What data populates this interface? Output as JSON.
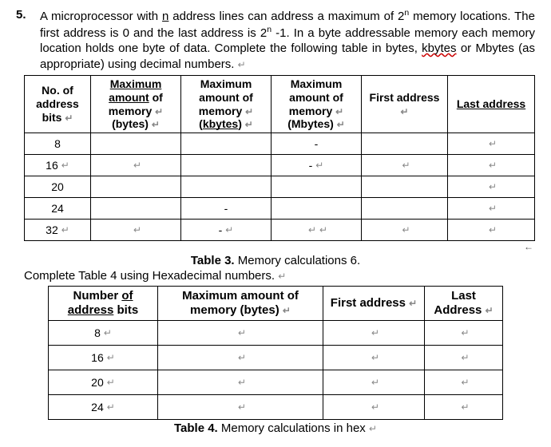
{
  "question": {
    "number": "5.",
    "text_part1": "A microprocessor with ",
    "text_n": "n",
    "text_part2": " address lines can address a maximum of 2",
    "text_exp": "n",
    "text_part3": " memory locations. The first address is 0 and the last address is 2",
    "text_exp2": "n",
    "text_part4": " -1.  In a byte addressable memory each memory location holds one byte of data. Complete the following table in bytes, ",
    "text_kbytes": "kbytes",
    "text_part5": " or Mbytes (as appropriate) using decimal numbers. "
  },
  "ret": "↵",
  "larrow": "←",
  "table3": {
    "headers": {
      "col1a": "No. of",
      "col1b": "address",
      "col1c": "bits ",
      "col2a": "Maximum",
      "col2b": "amount",
      "col2c": " of memory ",
      "col2d": "(bytes) ",
      "col3a": "Maximum amount of memory ",
      "col3b": "(",
      "col3c": "kbytes",
      "col3d": ") ",
      "col4a": "Maximum amount of memory ",
      "col4b": "(Mbytes) ",
      "col5": "First address ",
      "col6": "Last  address"
    },
    "rows": [
      {
        "bits": "8",
        "bytes": "",
        "kbytes": "",
        "mbytes": "-",
        "first": "",
        "last": ""
      },
      {
        "bits": "16 ",
        "bytes": "",
        "kbytes": "",
        "mbytes": "- ",
        "first": "",
        "last": ""
      },
      {
        "bits": "20",
        "bytes": "",
        "kbytes": "",
        "mbytes": "",
        "first": "",
        "last": ""
      },
      {
        "bits": "24",
        "bytes": "",
        "kbytes": "-",
        "mbytes": "",
        "first": "",
        "last": ""
      },
      {
        "bits": "32 ",
        "bytes": "",
        "kbytes": "- ",
        "mbytes": "",
        "first": "",
        "last": ""
      }
    ],
    "caption_bold": "Table 3.",
    "caption_rest": " Memory calculations 6."
  },
  "subline": "Complete Table 4 using Hexadecimal numbers.   ",
  "table4": {
    "headers": {
      "col1a": "Number ",
      "col1b": "of",
      "col1c": "address",
      "col1d": " bits",
      "col2": "Maximum amount of memory (bytes) ",
      "col3": "First address ",
      "col4": "Last Address "
    },
    "rows": [
      {
        "bits": "8 ",
        "mem": "",
        "first": "",
        "last": ""
      },
      {
        "bits": "16 ",
        "mem": "",
        "first": "",
        "last": ""
      },
      {
        "bits": "20 ",
        "mem": "",
        "first": "",
        "last": ""
      },
      {
        "bits": "24 ",
        "mem": "",
        "first": "",
        "last": ""
      }
    ],
    "caption_bold": "Table 4.",
    "caption_rest": " Memory calculations in hex "
  }
}
